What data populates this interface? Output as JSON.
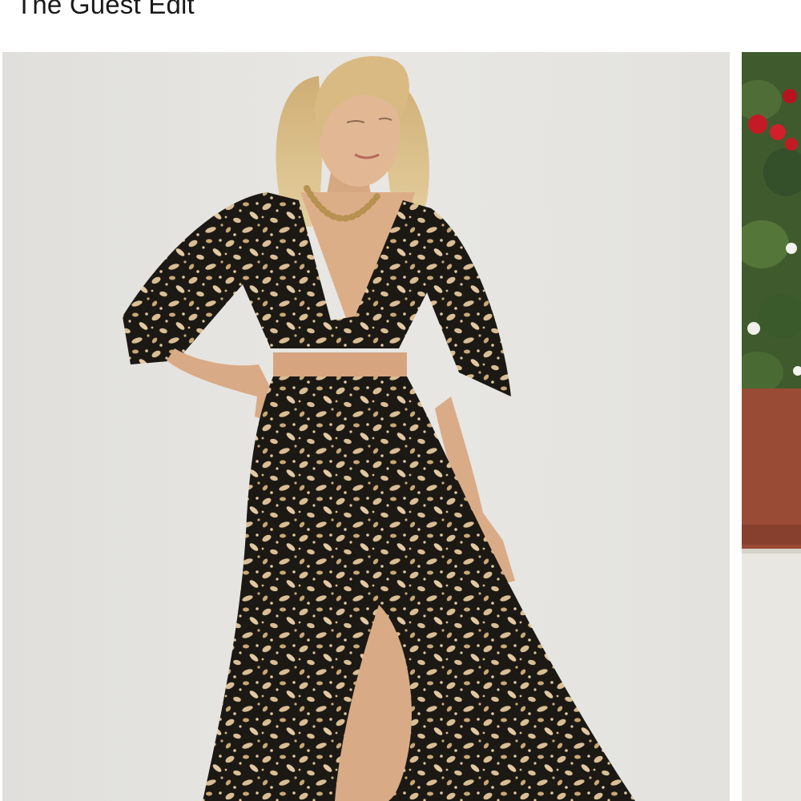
{
  "section": {
    "title": "The Guest Edit"
  },
  "carousel": {
    "cards": [
      {
        "image": "woman-in-animal-print-maxi-dress-photo",
        "colors": {
          "backdrop": "#e5e4e0",
          "print_dark": "#1c1914",
          "print_light": "#d9bd94",
          "skin": "#dcb089",
          "hair": "#dcc08e"
        }
      },
      {
        "image": "patio-with-red-flowers-photo",
        "colors": {
          "foliage": "#3f5a2c",
          "flowers": "#c41a25",
          "pot": "#9a4b36",
          "wall": "#e9e7e1"
        }
      }
    ]
  }
}
